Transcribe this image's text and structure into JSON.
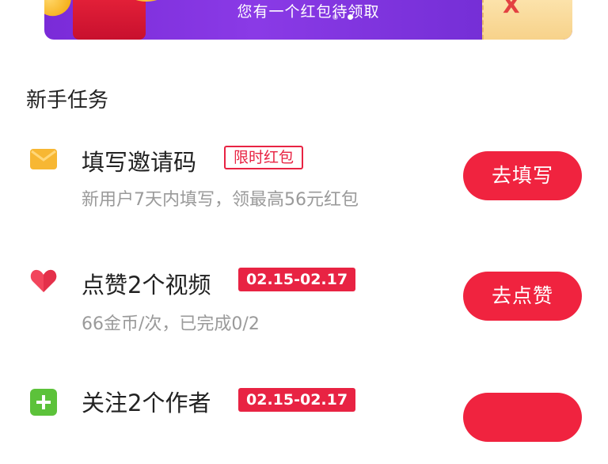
{
  "banner": {
    "text": "您有一个红包待领取",
    "ticket_mark": "X",
    "dots": [
      false,
      true
    ]
  },
  "section_title": "新手任务",
  "tasks": [
    {
      "icon": "envelope-icon",
      "icon_color": "#f7b733",
      "title": "填写邀请码",
      "tag": "限时红包",
      "tag_style": "outline",
      "subtitle": "新用户7天内填写，领最高56元红包",
      "button": "去填写"
    },
    {
      "icon": "heart-icon",
      "icon_color": "#f2455c",
      "title": "点赞2个视频",
      "tag": "02.15-02.17",
      "tag_style": "solid",
      "subtitle": "66金币/次，已完成0/2",
      "button": "去点赞"
    },
    {
      "icon": "add-user-icon",
      "icon_color": "#5cc23a",
      "title": "关注2个作者",
      "tag": "02.15-02.17",
      "tag_style": "solid",
      "subtitle": "",
      "button": ""
    }
  ],
  "colors": {
    "accent": "#f0233f",
    "banner_purple": "#7a2bd8"
  }
}
